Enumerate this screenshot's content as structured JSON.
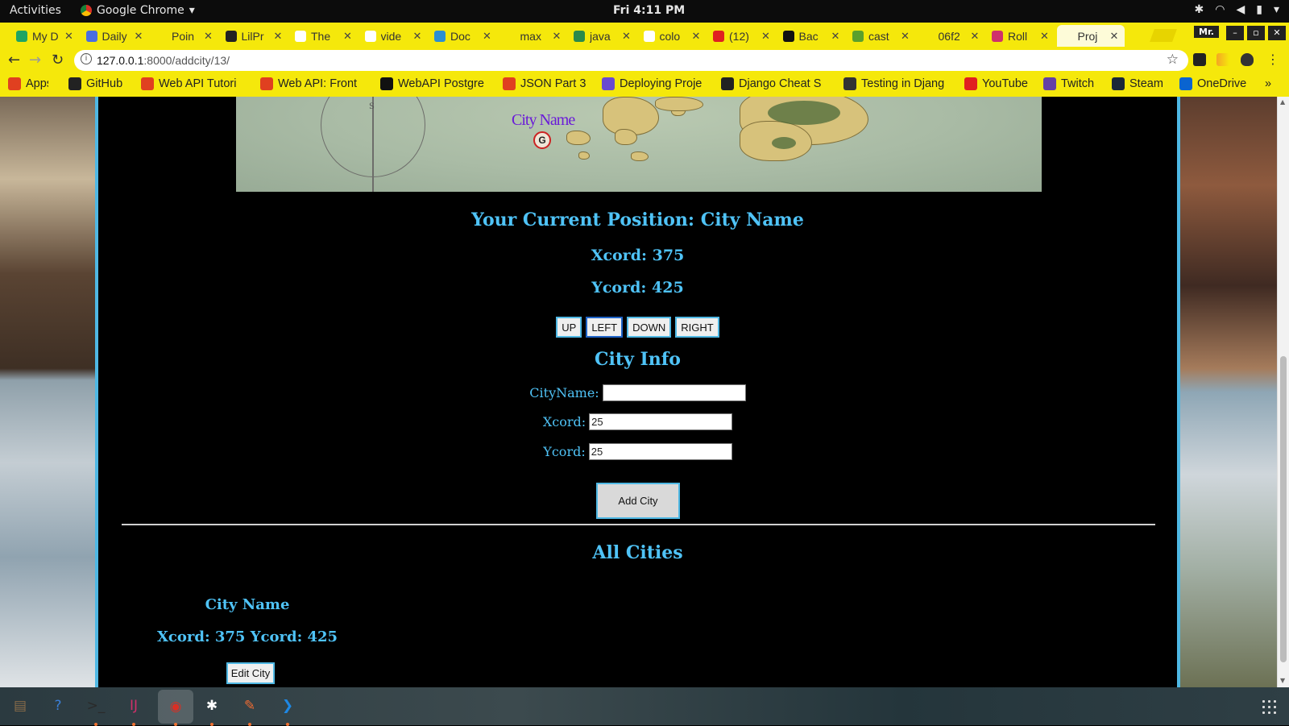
{
  "system": {
    "activities": "Activities",
    "app_name": "Google Chrome",
    "clock": "Fri  4:11 PM",
    "profile": "Mr."
  },
  "tabs": [
    {
      "title": "My D",
      "favicon": "drive-icon",
      "color": "#1fa463"
    },
    {
      "title": "Daily",
      "favicon": "docs-icon",
      "color": "#4a6ee0"
    },
    {
      "title": "Poin",
      "favicon": "page-icon",
      "color": "#f5e80b"
    },
    {
      "title": "LilPr",
      "favicon": "github-icon",
      "color": "#222222"
    },
    {
      "title": "The",
      "favicon": "google-icon",
      "color": "#ffffff"
    },
    {
      "title": "vide",
      "favicon": "google-icon",
      "color": "#ffffff"
    },
    {
      "title": "Doc",
      "favicon": "docs-icon",
      "color": "#2b8fd1"
    },
    {
      "title": "max",
      "favicon": "page-icon",
      "color": "#f5e80b"
    },
    {
      "title": "java",
      "favicon": "cloud-icon",
      "color": "#2a8a4a"
    },
    {
      "title": "colo",
      "favicon": "google-icon",
      "color": "#ffffff"
    },
    {
      "title": "(12)",
      "favicon": "youtube-icon",
      "color": "#e02020"
    },
    {
      "title": "Bac",
      "favicon": "bold-b-icon",
      "color": "#111111"
    },
    {
      "title": "cast",
      "favicon": "leaf-icon",
      "color": "#5aa02c"
    },
    {
      "title": "06f2",
      "favicon": "page-icon",
      "color": "#f5e80b"
    },
    {
      "title": "Roll",
      "favicon": "roll-icon",
      "color": "#d0306a"
    },
    {
      "title": "Proj",
      "favicon": "page-icon",
      "color": "#fdfbd8"
    }
  ],
  "address_bar": {
    "host": "127.0.0.1",
    "path": ":8000/addcity/13/"
  },
  "bookmarks": [
    {
      "label": "Apps",
      "icon": "apps-grid-icon",
      "color": "#e04020"
    },
    {
      "label": "GitHub",
      "icon": "github-icon",
      "color": "#222222"
    },
    {
      "label": "Web API Tutori",
      "icon": "microsoft-icon",
      "color": "#e04020"
    },
    {
      "label": "Web API: Front",
      "icon": "microsoft-icon",
      "color": "#e04020"
    },
    {
      "label": "WebAPI Postgre",
      "icon": "medium-icon",
      "color": "#111111"
    },
    {
      "label": "JSON Part 3",
      "icon": "microsoft-icon",
      "color": "#e04020"
    },
    {
      "label": "Deploying Proje",
      "icon": "docs-icon",
      "color": "#6a4ad0"
    },
    {
      "label": "Django Cheat S",
      "icon": "github-icon",
      "color": "#222222"
    },
    {
      "label": "Testing in Djang",
      "icon": "circle-icon",
      "color": "#333333"
    },
    {
      "label": "YouTube",
      "icon": "youtube-icon",
      "color": "#e02020"
    },
    {
      "label": "Twitch",
      "icon": "twitch-icon",
      "color": "#6441a4"
    },
    {
      "label": "Steam",
      "icon": "steam-icon",
      "color": "#1b2838"
    },
    {
      "label": "OneDrive",
      "icon": "onedrive-icon",
      "color": "#0a64d0"
    }
  ],
  "page": {
    "map_label": "City Name",
    "map_marker": "G",
    "position_heading": "Your Current Position: City Name",
    "xcord_line": "Xcord: 375",
    "ycord_line": "Ycord: 425",
    "move_buttons": {
      "up": "UP",
      "left": "LEFT",
      "down": "DOWN",
      "right": "RIGHT"
    },
    "city_info_heading": "City Info",
    "form": {
      "cityname_label": "CityName:",
      "cityname_value": "",
      "xcord_label": "Xcord:",
      "xcord_value": "25",
      "ycord_label": "Ycord:",
      "ycord_value": "25",
      "submit": "Add City"
    },
    "all_cities_heading": "All Cities",
    "cities": [
      {
        "name": "City Name",
        "coords": "Xcord: 375 Ycord: 425",
        "edit": "Edit City"
      }
    ]
  },
  "colors": {
    "accent_text": "#4fc3f7",
    "chrome_theme": "#f5e80b",
    "map_label": "#6a1bd8"
  },
  "dock": [
    {
      "name": "files-icon",
      "glyph": "▤",
      "color": "#8a6d4a"
    },
    {
      "name": "help-icon",
      "glyph": "?",
      "color": "#3b7fd6"
    },
    {
      "name": "terminal-icon",
      "glyph": ">_",
      "color": "#2a2a2a"
    },
    {
      "name": "intellij-icon",
      "glyph": "IJ",
      "color": "#d0306a"
    },
    {
      "name": "chrome-icon",
      "glyph": "◉",
      "color": "#d93025"
    },
    {
      "name": "slack-icon",
      "glyph": "✱",
      "color": "#ffffff"
    },
    {
      "name": "postman-icon",
      "glyph": "✎",
      "color": "#ef6c33"
    },
    {
      "name": "vscode-icon",
      "glyph": "❯",
      "color": "#1e88e5"
    }
  ]
}
